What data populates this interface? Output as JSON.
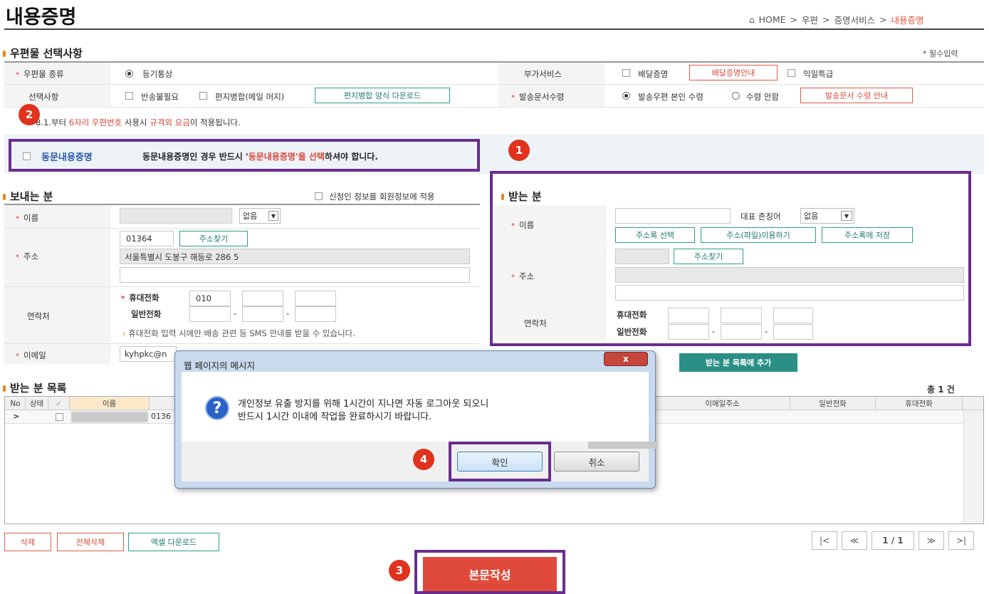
{
  "page": {
    "title": "내용증명",
    "required_note": "* 필수입력"
  },
  "breadcrumb": {
    "home": "HOME",
    "sep": ">",
    "item1": "우편",
    "item2": "증명서비스",
    "current": "내용증명"
  },
  "options": {
    "section": "우편물 선택사항",
    "mail_type_label": "우편물 종류",
    "mail_type_value": "등기통상",
    "extra_label": "부가서비스",
    "delivery_proof": "배달증명",
    "delivery_proof_btn": "배달증명안내",
    "next_day": "익일특급",
    "choice_label": "선택사항",
    "return_needed": "반송불필요",
    "mail_merge": "편지병합(메일 머지)",
    "merge_download": "편지병합 양식 다운로드",
    "receipt_label": "발송문서수령",
    "receipt_self": "발송우편 본인 수령",
    "receipt_none": "수령 안함",
    "receipt_btn": "발송문서 수령 안내",
    "notice_prefix": "8.1.부터 ",
    "notice_hl1": "6자리 우편번호",
    "notice_mid": " 사용시 ",
    "notice_hl2": "규격외 요금",
    "notice_suffix": "이 적용됩니다."
  },
  "joint": {
    "label": "동문내용증명",
    "text_a": "동문내용증명인 경우 반드시 '",
    "text_hl": "동문내용증명'을 선택",
    "text_b": "하셔야 합니다."
  },
  "sender": {
    "section": "보내는 분",
    "apply_member": "신청인 정보를 회원정보에 적용",
    "name_label": "이름",
    "honorific": "없음",
    "address_label": "주소",
    "zip": "01364",
    "find_address": "주소찾기",
    "address1": "서울특별시 도봉구 해등로 286 5",
    "contact_label": "연락처",
    "mobile_label": "휴대전화",
    "mobile1": "010",
    "phone_label": "일반전화",
    "dash": "-",
    "sms_note": "휴대전화 입력 시에만 배송 관련 등 SMS 안내를 받을 수 있습니다.",
    "email_label": "이메일",
    "email_value": "kyhpkc@n"
  },
  "receiver": {
    "section": "받는 분",
    "name_label": "이름",
    "rep_honorific_label": "대표 존칭어",
    "honorific": "없음",
    "address_book_select": "주소록 선택",
    "address_file": "주소(파일)이용하기",
    "save_address_book": "주소록에 저장",
    "address_label": "주소",
    "find_address": "주소찾기",
    "contact_label": "연락처",
    "mobile_label": "휴대전화",
    "phone_label": "일반전화",
    "dash": "-",
    "add_to_list": "받는 분 목록에 추가"
  },
  "list": {
    "section": "받는 분 목록",
    "total": "총 1 건",
    "columns": {
      "no": "No",
      "status": "상태",
      "check": "✓",
      "name": "이름",
      "email": "이메일주소",
      "phone": "일반전화",
      "mobile": "휴대전화"
    },
    "row": {
      "marker": ">",
      "zip_partial": "0136"
    },
    "delete": "삭제",
    "delete_all": "전체삭제",
    "excel_download": "엑셀 다운로드",
    "page_first": "|<",
    "page_prev": "≪",
    "page_info": "1 / 1",
    "page_next": "≫",
    "page_last": ">|"
  },
  "compose": {
    "label": "본문작성"
  },
  "dialog": {
    "title": "웹 페이지의 메시지",
    "close": "x",
    "line1": "개인정보 유출 방지를 위해 1시간이 지나면 자동 로그아웃 되오니",
    "line2": "반드시 1시간 이내에 작업을 완료하시기 바랍니다.",
    "ok": "확인",
    "cancel": "취소"
  },
  "markers": {
    "m1": "1",
    "m2": "2",
    "m3": "3",
    "m4": "4"
  },
  "colors": {
    "accent_red": "#d8463a",
    "highlight_purple": "#6a2d8f",
    "teal": "#2a9d8f"
  }
}
